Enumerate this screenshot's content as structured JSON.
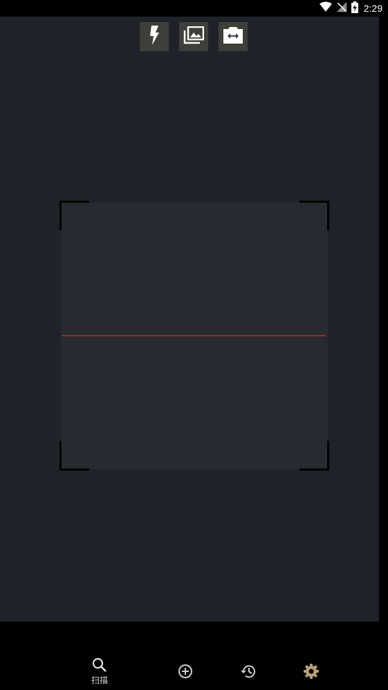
{
  "status_bar": {
    "time": "2:29",
    "icons": [
      "wifi-icon",
      "no-signal-icon",
      "battery-charging-icon"
    ]
  },
  "toolbar": {
    "buttons": [
      {
        "name": "flash-button",
        "icon": "flash-icon"
      },
      {
        "name": "gallery-button",
        "icon": "gallery-icon"
      },
      {
        "name": "switch-camera-button",
        "icon": "switch-camera-icon"
      }
    ]
  },
  "scanner": {
    "laser_color": "#a3262a",
    "frame_color": "#262b31"
  },
  "bottom_nav": {
    "items": [
      {
        "name": "nav-scan",
        "icon": "search-icon",
        "label": "扫描",
        "active": true
      },
      {
        "name": "nav-create",
        "icon": "add-circle-icon",
        "label": "",
        "active": false
      },
      {
        "name": "nav-history",
        "icon": "history-icon",
        "label": "",
        "active": false
      },
      {
        "name": "nav-settings",
        "icon": "gear-icon",
        "label": "",
        "active": false
      }
    ],
    "settings_color": "#b59f74"
  }
}
